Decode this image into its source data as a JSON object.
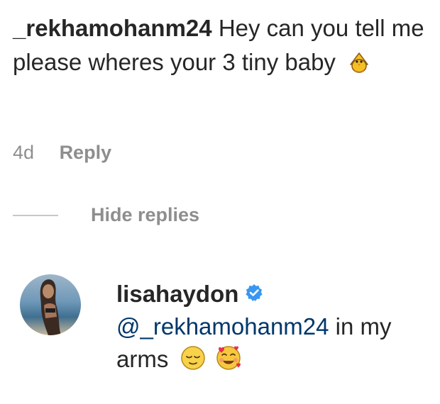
{
  "comment": {
    "username": "_rekhamohanm24",
    "text": "Hey can you tell me please wheres your 3 tiny baby",
    "emoji_icon": "baby-chick-icon"
  },
  "comment_meta": {
    "age": "4d",
    "reply_label": "Reply"
  },
  "replies_toggle": {
    "label": "Hide replies"
  },
  "reply": {
    "username": "lisahaydon",
    "verified_icon": "verified-badge-icon",
    "mention": "@_rekhamohanm24",
    "text": "in my arms",
    "emoji_icons": [
      "relieved-face-icon",
      "smiling-face-with-hearts-icon"
    ]
  },
  "colors": {
    "text": "#262626",
    "muted": "#8e8e8e",
    "mention": "#00376b",
    "verified": "#3897f0"
  }
}
